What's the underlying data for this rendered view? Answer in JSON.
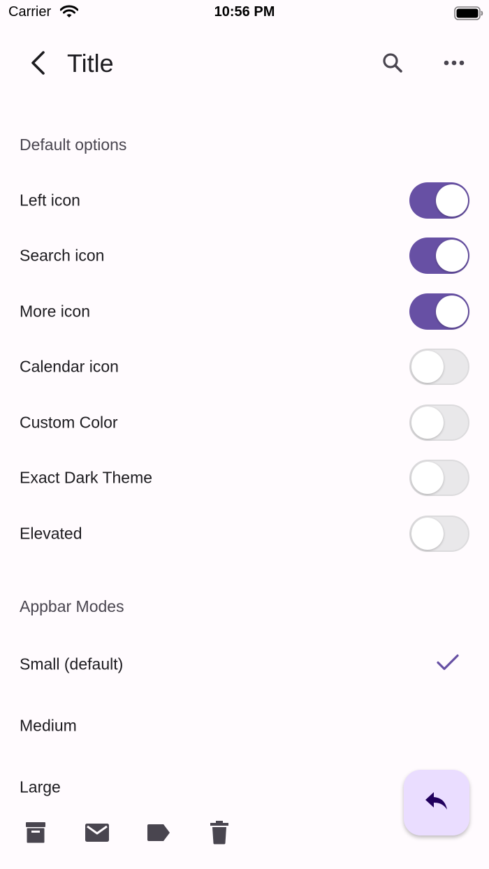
{
  "status_bar": {
    "carrier": "Carrier",
    "time": "10:56 PM"
  },
  "appbar": {
    "title": "Title",
    "icons": [
      "back-arrow",
      "search",
      "more-horizontal"
    ]
  },
  "default_options": {
    "header": "Default options",
    "items": [
      {
        "label": "Left icon",
        "on": true
      },
      {
        "label": "Search icon",
        "on": true
      },
      {
        "label": "More icon",
        "on": true
      },
      {
        "label": "Calendar icon",
        "on": false
      },
      {
        "label": "Custom Color",
        "on": false
      },
      {
        "label": "Exact Dark Theme",
        "on": false
      },
      {
        "label": "Elevated",
        "on": false
      }
    ]
  },
  "appbar_modes": {
    "header": "Appbar Modes",
    "items": [
      {
        "label": "Small (default)",
        "selected": true
      },
      {
        "label": "Medium",
        "selected": false
      },
      {
        "label": "Large",
        "selected": false
      }
    ]
  },
  "bottom_bar": {
    "icons": [
      "archive",
      "mail",
      "label",
      "delete"
    ]
  },
  "fab": {
    "icon": "reply"
  },
  "colors": {
    "primary": "#6750a4",
    "fab_container": "#eaddff",
    "background": "#fffbfe",
    "on_fab": "#21005d"
  }
}
